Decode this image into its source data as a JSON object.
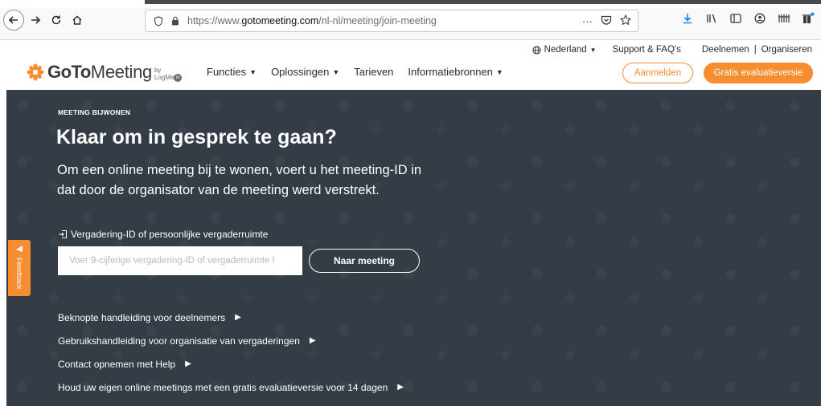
{
  "browser": {
    "url_prefix": "https://www.",
    "url_host": "gotomeeting.com",
    "url_path": "/nl-nl/meeting/join-meeting",
    "page_actions_label": "···"
  },
  "site_header": {
    "utility_nav": {
      "language": "Nederland",
      "support": "Support & FAQ's",
      "join": "Deelnemen",
      "separator": "|",
      "organize": "Organiseren"
    },
    "logo": {
      "goto": "GoTo",
      "meeting": "Meeting",
      "by": "by",
      "logmein": "LogMe"
    },
    "main_nav": [
      {
        "label": "Functies",
        "has_dropdown": true
      },
      {
        "label": "Oplossingen",
        "has_dropdown": true
      },
      {
        "label": "Tarieven",
        "has_dropdown": false
      },
      {
        "label": "Informatiebronnen",
        "has_dropdown": true
      }
    ],
    "signin_label": "Aanmelden",
    "trial_label": "Gratis evaluatieversie"
  },
  "hero": {
    "eyebrow": "MEETING BIJWONEN",
    "headline": "Klaar om in gesprek te gaan?",
    "subline": "Om een online meeting bij te wonen, voert u het meeting-ID in dat door de organisator van de meeting werd verstrekt.",
    "field_label": "Vergadering-ID of persoonlijke vergaderruimte",
    "input_placeholder": "Voer 9-cijferige vergadering-ID of vergaderruimte l",
    "input_value": "",
    "join_button": "Naar meeting",
    "links": [
      "Beknopte handleiding voor deelnemers",
      "Gebruikshandleiding voor organisatie van vergaderingen",
      "Contact opnemen met Help",
      "Houd uw eigen online meetings met een gratis evaluatieversie voor 14 dagen"
    ]
  },
  "feedback_tab": {
    "label": "Feedback"
  },
  "colors": {
    "accent": "#f68d2e",
    "hero_bg": "#343c46"
  }
}
